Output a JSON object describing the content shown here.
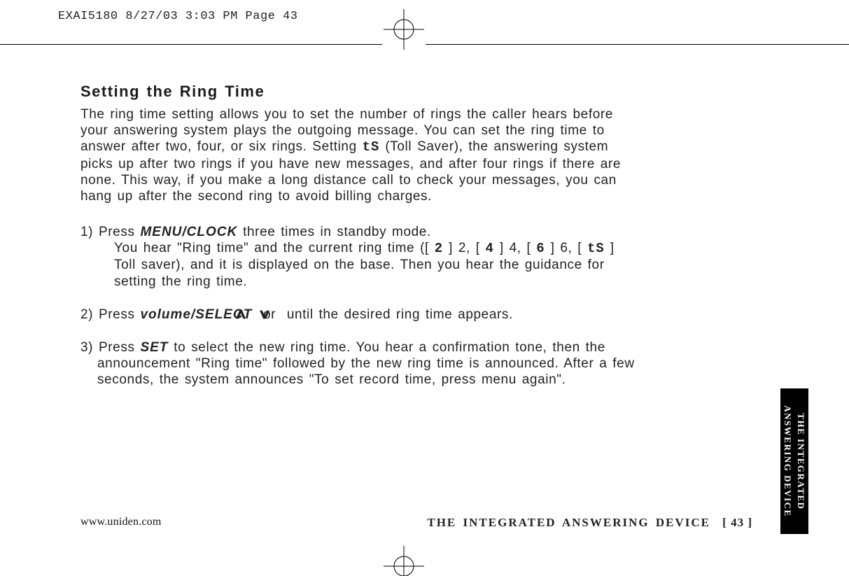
{
  "slug": "EXAI5180  8/27/03 3:03 PM  Page 43",
  "title": "Setting the Ring Time",
  "intro_before_ts": "The ring time setting allows you to set the number of rings the caller hears before your answering system plays the outgoing message. You can set the ring time to answer after two, four, or six rings. Setting ",
  "ts_glyph": "tS",
  "intro_after_ts": " (Toll Saver), the answering system picks up after two rings if you have new messages, and after four rings if there are none. This way, if you make a long distance call to check your messages, you can hang up after the second ring to avoid billing charges.",
  "step1": {
    "num": "1) ",
    "lead": "Press ",
    "kw": "MENU/CLOCK",
    "after_kw": " three times in standby mode.",
    "line2a": "You hear \"Ring time\" and the current ring time ([",
    "g2": "2",
    "mid24": "] 2, [",
    "g4": "4",
    "mid46": "] 4, [",
    "g6": "6",
    "mid6ts": "] 6, [",
    "gts": "tS",
    "line2b": "] Toll saver), and it is displayed on the base. Then you hear the guidance for setting the ring time."
  },
  "step2": {
    "num": "2) ",
    "lead": "Press ",
    "kw": "volume/SELECT",
    "mid1": " ",
    "up": "∧",
    "mid2": " or ",
    "dn": "∨",
    "tail": " until the desired ring time appears."
  },
  "step3": {
    "num": "3) ",
    "lead": "Press ",
    "kw": "SET",
    "tail": " to select the new ring time. You hear a confirmation tone, then the announcement \"Ring time\" followed by the new ring time is announced. After a few seconds, the system announces \"To set record time, press menu again\"."
  },
  "footer": {
    "url": "www.uniden.com",
    "chapter": "THE INTEGRATED ANSWERING DEVICE",
    "page": "[ 43 ]"
  },
  "tab": {
    "line1": "THE INTEGRATED",
    "line2": "ANSWERING DEVICE"
  }
}
